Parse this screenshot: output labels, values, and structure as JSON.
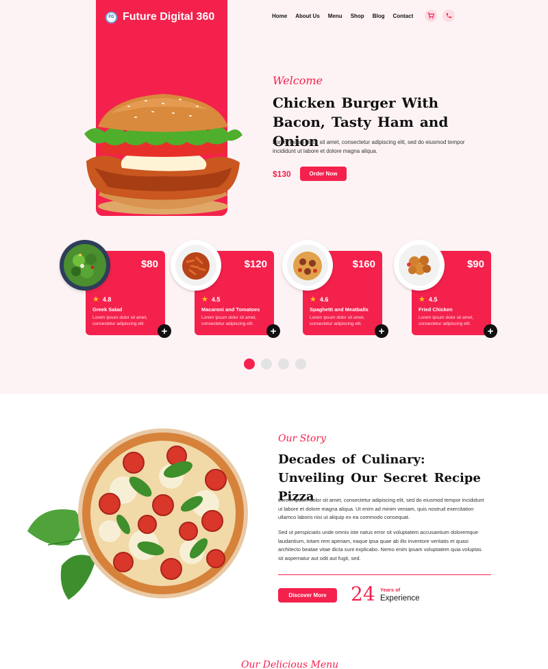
{
  "header": {
    "brand_name": "Future Digital 360",
    "logo_text": "FD",
    "nav": [
      "Home",
      "About Us",
      "Menu",
      "Shop",
      "Blog",
      "Contact"
    ],
    "icons": [
      "cart-icon",
      "phone-icon"
    ]
  },
  "hero": {
    "welcome": "Welcome",
    "title": "Chicken Burger With Bacon, Tasty Ham and Onion",
    "description": "Lorem ipsum dolor sit amet, consectetur adipiscing elit, sed do eiusmod tempor incididunt ut labore et dolore magna aliqua.",
    "price": "$130",
    "order_button": "Order Now"
  },
  "cards": [
    {
      "price": "$80",
      "rating": "4.8",
      "name": "Greek Salad",
      "desc": "Lorem ipsum dolor sit amet, consectetur adipiscing elit."
    },
    {
      "price": "$120",
      "rating": "4.5",
      "name": "Macaroni and Tomatoes",
      "desc": "Lorem ipsum dolor sit amet, consectetur adipiscing elit."
    },
    {
      "price": "$160",
      "rating": "4.6",
      "name": "Spaghetti and Meatballs",
      "desc": "Lorem ipsum dolor sit amet, consectetur adipiscing elit."
    },
    {
      "price": "$90",
      "rating": "4.5",
      "name": "Fried Chicken",
      "desc": "Lorem ipsum dolor sit amet, consectetur adipiscing elit."
    }
  ],
  "carousel": {
    "active_index": 0,
    "count": 4
  },
  "story": {
    "label": "Our Story",
    "title": "Decades of Culinary: Unveiling Our Secret Recipe Pizza",
    "p1": "Lorem ipsum dolor sit amet, consectetur adipiscing elit, sed do eiusmod tempor incididunt ut labore et dolore magna aliqua. Ut enim ad minim veniam, quis nostrud exercitation ullamco laboris nisi ut aliquip ex ea commodo consequat.",
    "p2": "Sed ut perspiciatis unde omnis iste natus error sit voluptatem accusantium doloremque laudantium, totam rem aperiam, eaque ipsa quae ab illo inventore veritatis et quasi architecto beatae vitae dicta sunt explicabo. Nemo enim ipsam voluptatem quia voluptas sit aspernatur aut odit aut fugit, sed.",
    "discover_button": "Discover More",
    "years_number": "24",
    "years_label": "Years of",
    "years_experience": "Experience"
  },
  "next_section_label": "Our Delicious Menu",
  "colors": {
    "accent": "#f4214d",
    "hero_bg": "#fdf3f4",
    "star": "#ffc61a"
  }
}
